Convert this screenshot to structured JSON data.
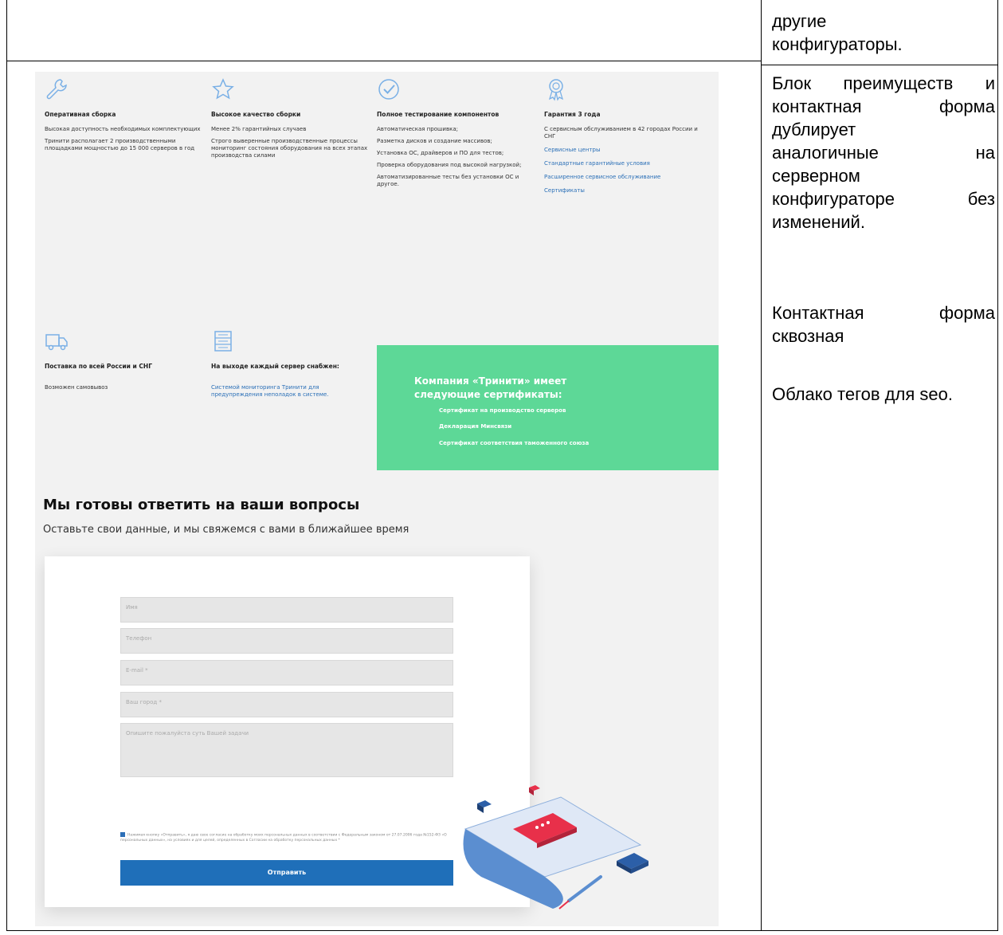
{
  "notes": {
    "top_text": [
      "другие",
      "конфигураторы."
    ],
    "block1": [
      "Блок преимуществ и",
      "контактная форма",
      "дублирует",
      "аналогичные на",
      "серверном",
      "конфигураторе без",
      "изменений."
    ],
    "block2": [
      "Контактная форма",
      "сквозная"
    ],
    "block3": "Облако тегов для seo."
  },
  "features_row1": [
    {
      "icon": "wrench-icon",
      "title": "Оперативная сборка",
      "paragraphs": [
        "Высокая доступность необходимых комплектующих",
        "Тринити располагает 2 производственными площадками мощностью до 15 000 серверов в год"
      ],
      "links": []
    },
    {
      "icon": "star-icon",
      "title": "Высокое качество сборки",
      "paragraphs": [
        "Менее 2% гарантийных случаев",
        "Строго выверенные производственные процессы мониторинг состояния оборудования на всех этапах производства силами"
      ],
      "links": []
    },
    {
      "icon": "check-circle-icon",
      "title": "Полное тестирование компонентов",
      "paragraphs": [
        "Автоматическая прошивка;",
        "Разметка дисков и создание массивов;",
        "Установка ОС, драйверов и ПО для тестов;",
        "Проверка оборудования под высокой нагрузкой;",
        "Автоматизированные тесты без установки ОС и другое."
      ],
      "links": []
    },
    {
      "icon": "award-icon",
      "title": "Гарантия 3 года",
      "paragraphs": [
        "С сервисным обслуживанием в 42 городах России и СНГ"
      ],
      "links": [
        "Сервисные центры",
        "Стандартные гарантийные условия",
        "Расширенное сервисное обслуживание",
        "Сертификаты"
      ]
    }
  ],
  "features_row2": [
    {
      "icon": "truck-icon",
      "title": "Поставка по всей России и СНГ",
      "paragraphs": [
        "Возможен самовывоз"
      ],
      "links": []
    },
    {
      "icon": "list-icon",
      "title": "На выходе каждый сервер снабжен:",
      "paragraphs": [],
      "links": [
        "Системой мониторинга Тринити для предупреждения неполадок в системе."
      ]
    }
  ],
  "certificates": {
    "title": "Компания «Тринити» имеет следующие сертификаты:",
    "items": [
      "Сертификат на производство серверов",
      "Декларация Минсвязи",
      "Сертификат соответствия таможенного союза"
    ]
  },
  "contact": {
    "title": "Мы готовы ответить на ваши вопросы",
    "subtitle": "Оставьте свои данные, и мы свяжемся с вами в ближайшее время",
    "fields": [
      "Имя",
      "Телефон",
      "E-mail *",
      "Ваш город *",
      "Опишите пожалуйста суть Вашей задачи"
    ],
    "consent": "Нажимая кнопку «Отправить», я даю свое согласие на обработку моих персональных данных в соответствии с Федеральным законом от 27.07.2006 года №152-ФЗ «О персональных данных», на условиях и для целей, определенных в Согласии на обработку персональных данных *",
    "submit": "Отправить"
  },
  "colors": {
    "accent_green": "#5dd897",
    "button_blue": "#1f6fb9",
    "link_blue": "#2a6fb7"
  }
}
